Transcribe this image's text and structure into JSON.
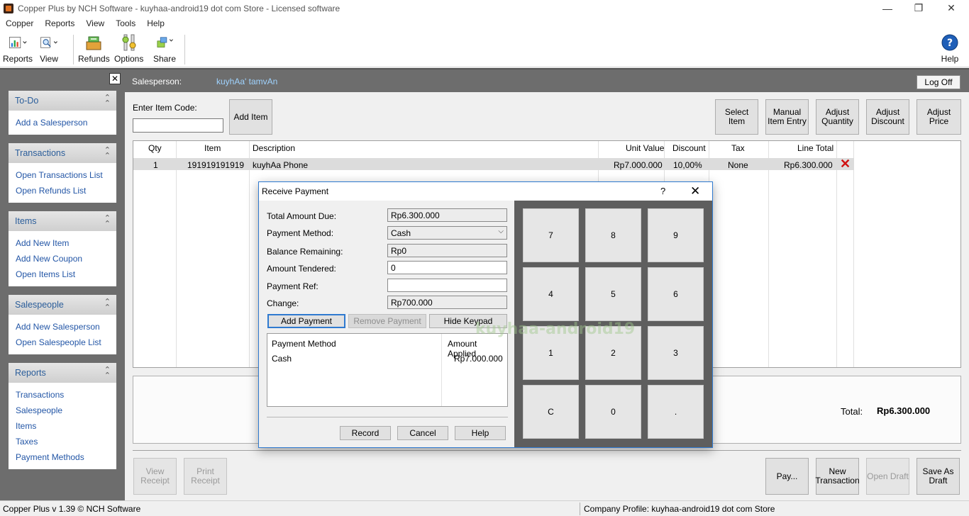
{
  "window": {
    "title": "Copper Plus by NCH Software - kuyhaa-android19 dot com Store - Licensed software",
    "controls": [
      "—",
      "❐",
      "✕"
    ]
  },
  "menu": [
    "Copper",
    "Reports",
    "View",
    "Tools",
    "Help"
  ],
  "toolbar": {
    "reports": "Reports",
    "view": "View",
    "refunds": "Refunds",
    "options": "Options",
    "share": "Share",
    "help": "Help"
  },
  "sidebar": {
    "close_glyph": "✕",
    "todo": {
      "title": "To-Do",
      "links": [
        "Add a Salesperson"
      ]
    },
    "transactions": {
      "title": "Transactions",
      "links": [
        "Open Transactions List",
        "Open Refunds List"
      ]
    },
    "items": {
      "title": "Items",
      "links": [
        "Add New Item",
        "Add New Coupon",
        "Open Items List"
      ]
    },
    "salespeople": {
      "title": "Salespeople",
      "links": [
        "Add New Salesperson",
        "Open Salespeople List"
      ]
    },
    "reports": {
      "title": "Reports",
      "links": [
        "Transactions",
        "Salespeople",
        "Items",
        "Taxes",
        "Payment Methods"
      ]
    }
  },
  "sales": {
    "label": "Salesperson:",
    "name": "kuyhAa' tamvAn",
    "logoff": "Log Off"
  },
  "entry": {
    "code_label": "Enter Item Code:",
    "code_value": "",
    "add_item": "Add Item",
    "select_item": "Select Item",
    "manual_entry_1": "Manual",
    "manual_entry_2": "Item Entry",
    "adjust_qty_1": "Adjust",
    "adjust_qty_2": "Quantity",
    "adjust_disc_1": "Adjust",
    "adjust_disc_2": "Discount",
    "adjust_price": "Adjust Price"
  },
  "grid": {
    "headers": [
      "Qty",
      "Item",
      "Description",
      "Unit Value",
      "Discount",
      "Tax",
      "Line Total"
    ],
    "rows": [
      [
        "1",
        "191919191919",
        "kuyhAa Phone",
        "Rp7.000.000",
        "10,00%",
        "None",
        "Rp6.300.000"
      ]
    ],
    "delete_glyph": "✕"
  },
  "totals": {
    "label": "Total:",
    "value": "Rp6.300.000"
  },
  "bottom": {
    "view_receipt_1": "View",
    "view_receipt_2": "Receipt",
    "print_receipt_1": "Print",
    "print_receipt_2": "Receipt",
    "pay": "Pay...",
    "new_txn_1": "New",
    "new_txn_2": "Transaction",
    "open_draft": "Open Draft",
    "save_draft_1": "Save As",
    "save_draft_2": "Draft"
  },
  "status": {
    "left": "Copper Plus v 1.39 © NCH Software",
    "right": "Company Profile: kuyhaa-android19 dot com Store"
  },
  "dialog": {
    "title": "Receive Payment",
    "help_glyph": "?",
    "close_glyph": "✕",
    "total_due_label": "Total Amount Due:",
    "total_due": "Rp6.300.000",
    "method_label": "Payment Method:",
    "method": "Cash",
    "balance_label": "Balance Remaining:",
    "balance": "Rp0",
    "tendered_label": "Amount Tendered:",
    "tendered": "0",
    "ref_label": "Payment Ref:",
    "ref": "",
    "change_label": "Change:",
    "change": "Rp700.000",
    "add_payment": "Add Payment",
    "remove_payment": "Remove Payment",
    "hide_keypad": "Hide Keypad",
    "list_headers": [
      "Payment Method",
      "Amount Applied"
    ],
    "list_rows": [
      [
        "Cash",
        "Rp7.000.000"
      ]
    ],
    "record": "Record",
    "cancel": "Cancel",
    "help": "Help",
    "keys": [
      "7",
      "8",
      "9",
      "4",
      "5",
      "6",
      "1",
      "2",
      "3",
      "C",
      "0",
      "."
    ]
  },
  "watermark": "kuyhaa-android19",
  "colors": {
    "link": "#2356a6",
    "panel_title": "#2a5d9a",
    "sidebar_bg": "#6d6d6d",
    "accent": "#2f7ad0",
    "delete": "#d01010",
    "salesperson": "#9fd3ff"
  }
}
